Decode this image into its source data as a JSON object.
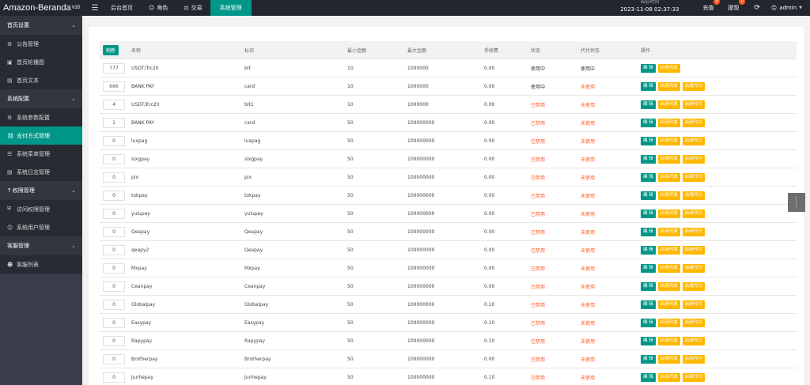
{
  "app": {
    "title": "Amazon-Beranda",
    "version": "V20"
  },
  "topnav": [
    {
      "icon": "",
      "label": "后台首页"
    },
    {
      "icon": "user-icon",
      "label": "角色"
    },
    {
      "icon": "scale-icon",
      "label": "交易"
    },
    {
      "icon": "",
      "label": "系统管理",
      "active": true
    }
  ],
  "topright": {
    "clock_label": "当前时间",
    "clock_value": "2023-11-08 02:37:33",
    "recharge_label": "充值",
    "recharge_badge": "0",
    "withdraw_label": "提现",
    "withdraw_badge": "0",
    "user": "admin"
  },
  "sidebar": [
    {
      "type": "group",
      "label": "首页设置"
    },
    {
      "type": "item",
      "icon": "settings-icon",
      "label": "公告管理"
    },
    {
      "type": "item",
      "icon": "image-icon",
      "label": "首页轮播图"
    },
    {
      "type": "item",
      "icon": "document-icon",
      "label": "首页文本"
    },
    {
      "type": "group",
      "label": "系统配置"
    },
    {
      "type": "item",
      "icon": "gear-icon",
      "label": "系统参数配置"
    },
    {
      "type": "item",
      "icon": "link-icon",
      "label": "支付方式管理",
      "active": true
    },
    {
      "type": "item",
      "icon": "list-icon",
      "label": "系统菜单管理"
    },
    {
      "type": "item",
      "icon": "log-icon",
      "label": "系统日志管理"
    },
    {
      "type": "group",
      "label": "权限管理",
      "icon": "key-icon"
    },
    {
      "type": "item",
      "icon": "shield-icon",
      "label": "访问权限管理"
    },
    {
      "type": "item",
      "icon": "user-icon",
      "label": "系统用户管理"
    },
    {
      "type": "group",
      "label": "客服管理"
    },
    {
      "type": "item",
      "icon": "users-icon",
      "label": "客服列表"
    }
  ],
  "table": {
    "refresh_label": "刷新",
    "headers": {
      "name": "名称",
      "identifier": "标识",
      "min": "最小金额",
      "max": "最大金额",
      "fee": "手续费",
      "status": "状态",
      "dstatus": "代付状态",
      "ops": "操作"
    },
    "buttons": {
      "edit": "编 辑",
      "enable_collect": "启用代收",
      "enable_pay": "启用代付"
    },
    "rows": [
      {
        "sort": "777",
        "name": "USDT/Trc20",
        "id": "bit",
        "min": "10",
        "max": "1000000",
        "fee": "0.00",
        "status": "使用中",
        "status_on": true,
        "dstatus": "使用中",
        "dstatus_on": true,
        "ops": [
          "edit",
          "enable_collect"
        ]
      },
      {
        "sort": "666",
        "name": "BANK PAY",
        "id": "card",
        "min": "10",
        "max": "1000000",
        "fee": "0.00",
        "status": "使用中",
        "status_on": true,
        "dstatus": "未使用",
        "dstatus_on": false,
        "ops": [
          "edit",
          "enable_collect",
          "enable_pay"
        ]
      },
      {
        "sort": "4",
        "name": "USDT/Erc20",
        "id": "bit1",
        "min": "10",
        "max": "1000000",
        "fee": "0.00",
        "status": "已禁用",
        "status_on": false,
        "dstatus": "未使用",
        "dstatus_on": false,
        "ops": [
          "edit",
          "enable_collect",
          "enable_pay"
        ]
      },
      {
        "sort": "1",
        "name": "BANK PAY",
        "id": "card",
        "min": "50",
        "max": "100000000",
        "fee": "0.00",
        "status": "已禁用",
        "status_on": false,
        "dstatus": "未使用",
        "dstatus_on": false,
        "ops": [
          "edit",
          "enable_collect",
          "enable_pay"
        ]
      },
      {
        "sort": "0",
        "name": "luxpag",
        "id": "luxpag",
        "min": "50",
        "max": "100000000",
        "fee": "0.00",
        "status": "已禁用",
        "status_on": false,
        "dstatus": "未使用",
        "dstatus_on": false,
        "ops": [
          "edit",
          "enable_collect",
          "enable_pay"
        ]
      },
      {
        "sort": "0",
        "name": "sixgpay",
        "id": "sixgpay",
        "min": "50",
        "max": "100000000",
        "fee": "0.00",
        "status": "已禁用",
        "status_on": false,
        "dstatus": "未使用",
        "dstatus_on": false,
        "ops": [
          "edit",
          "enable_collect",
          "enable_pay"
        ]
      },
      {
        "sort": "0",
        "name": "pix",
        "id": "pix",
        "min": "50",
        "max": "100000000",
        "fee": "0.00",
        "status": "已禁用",
        "status_on": false,
        "dstatus": "未使用",
        "dstatus_on": false,
        "ops": [
          "edit",
          "enable_collect",
          "enable_pay"
        ]
      },
      {
        "sort": "0",
        "name": "tokpay",
        "id": "tokpay",
        "min": "50",
        "max": "100000000",
        "fee": "0.00",
        "status": "已禁用",
        "status_on": false,
        "dstatus": "未使用",
        "dstatus_on": false,
        "ops": [
          "edit",
          "enable_collect",
          "enable_pay"
        ]
      },
      {
        "sort": "0",
        "name": "yulupay",
        "id": "yulupay",
        "min": "50",
        "max": "100000000",
        "fee": "0.00",
        "status": "已禁用",
        "status_on": false,
        "dstatus": "未使用",
        "dstatus_on": false,
        "ops": [
          "edit",
          "enable_collect",
          "enable_pay"
        ]
      },
      {
        "sort": "0",
        "name": "Qeapay",
        "id": "Qeapay",
        "min": "50",
        "max": "100000000",
        "fee": "0.00",
        "status": "已禁用",
        "status_on": false,
        "dstatus": "未使用",
        "dstatus_on": false,
        "ops": [
          "edit",
          "enable_collect",
          "enable_pay"
        ]
      },
      {
        "sort": "0",
        "name": "qeapy2",
        "id": "Qeapay",
        "min": "50",
        "max": "100000000",
        "fee": "0.00",
        "status": "已禁用",
        "status_on": false,
        "dstatus": "未使用",
        "dstatus_on": false,
        "ops": [
          "edit",
          "enable_collect",
          "enable_pay"
        ]
      },
      {
        "sort": "0",
        "name": "Mxpay",
        "id": "Mxpay",
        "min": "50",
        "max": "100000000",
        "fee": "0.00",
        "status": "已禁用",
        "status_on": false,
        "dstatus": "未使用",
        "dstatus_on": false,
        "ops": [
          "edit",
          "enable_collect",
          "enable_pay"
        ]
      },
      {
        "sort": "0",
        "name": "Ceanpay",
        "id": "Ceanpay",
        "min": "50",
        "max": "100000000",
        "fee": "0.00",
        "status": "已禁用",
        "status_on": false,
        "dstatus": "未使用",
        "dstatus_on": false,
        "ops": [
          "edit",
          "enable_collect",
          "enable_pay"
        ]
      },
      {
        "sort": "0",
        "name": "Globalpay",
        "id": "Globalpay",
        "min": "50",
        "max": "100000000",
        "fee": "0.10",
        "status": "已禁用",
        "status_on": false,
        "dstatus": "未使用",
        "dstatus_on": false,
        "ops": [
          "edit",
          "enable_collect",
          "enable_pay"
        ]
      },
      {
        "sort": "0",
        "name": "Easypay",
        "id": "Easypay",
        "min": "50",
        "max": "100000000",
        "fee": "0.10",
        "status": "已禁用",
        "status_on": false,
        "dstatus": "未使用",
        "dstatus_on": false,
        "ops": [
          "edit",
          "enable_collect",
          "enable_pay"
        ]
      },
      {
        "sort": "0",
        "name": "Rapypay",
        "id": "Rapypay",
        "min": "50",
        "max": "100000000",
        "fee": "0.10",
        "status": "已禁用",
        "status_on": false,
        "dstatus": "未使用",
        "dstatus_on": false,
        "ops": [
          "edit",
          "enable_collect",
          "enable_pay"
        ]
      },
      {
        "sort": "0",
        "name": "Brotherpay",
        "id": "Brotherpay",
        "min": "50",
        "max": "100000000",
        "fee": "0.00",
        "status": "已禁用",
        "status_on": false,
        "dstatus": "未使用",
        "dstatus_on": false,
        "ops": [
          "edit",
          "enable_collect",
          "enable_pay"
        ]
      },
      {
        "sort": "0",
        "name": "Junhepay",
        "id": "Junhepay",
        "min": "50",
        "max": "100000000",
        "fee": "0.10",
        "status": "已禁用",
        "status_on": false,
        "dstatus": "未使用",
        "dstatus_on": false,
        "ops": [
          "edit",
          "enable_collect",
          "enable_pay"
        ]
      }
    ]
  },
  "colors": {
    "accent": "#009688",
    "warn": "#ffb800",
    "danger": "#ff5722",
    "sidebar_bg": "#393d49",
    "topbar_bg": "#23262e"
  }
}
